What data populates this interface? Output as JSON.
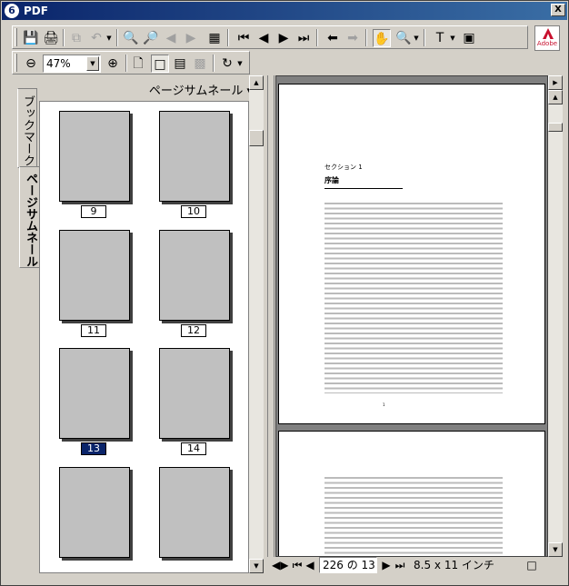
{
  "window": {
    "title": "PDF",
    "close_label": "X"
  },
  "toolbar": {
    "zoom_value": "47%",
    "adobe_logo": "Adobe"
  },
  "nav": {
    "tab_bookmarks": "ブックマーク",
    "tab_thumbnails": "ページサムネール",
    "panel_title": "ページサムネール ▾",
    "thumbnails": [
      {
        "label": "9",
        "selected": false
      },
      {
        "label": "10",
        "selected": false
      },
      {
        "label": "11",
        "selected": false
      },
      {
        "label": "12",
        "selected": false
      },
      {
        "label": "13",
        "selected": true
      },
      {
        "label": "14",
        "selected": false
      },
      {
        "label": "",
        "selected": false
      },
      {
        "label": "",
        "selected": false
      }
    ]
  },
  "document": {
    "section": "セクション 1",
    "heading": "序論",
    "page_number": "1"
  },
  "status": {
    "page_input": "226 の 13",
    "page_size": "8.5 x 11 インチ"
  }
}
